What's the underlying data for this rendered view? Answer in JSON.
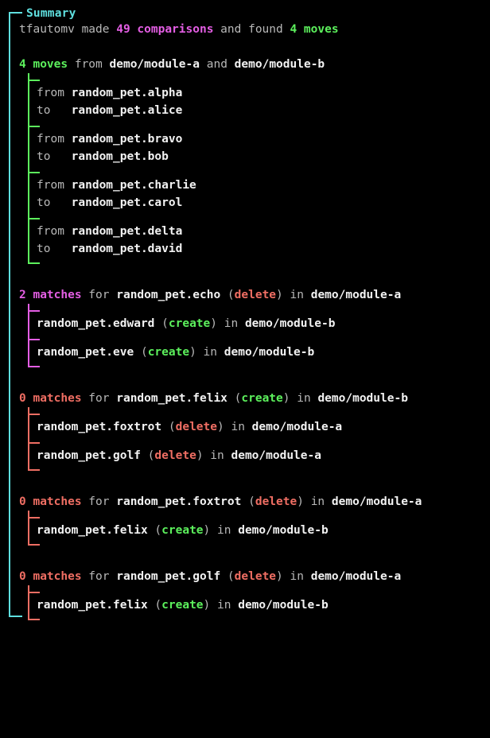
{
  "box": {
    "title": "Summary",
    "border_color": "#5fdfdf"
  },
  "summary_line": {
    "prefix": "tfautomv made ",
    "comparisons": "49 comparisons",
    "middle": " and found ",
    "moves": "4 moves"
  },
  "colors": {
    "green": "#5cf05c",
    "magenta": "#e45ee4",
    "salmon": "#ef6e63",
    "cyan": "#5fdfdf",
    "dim": "#b8b8b8",
    "white": "#f2f2f2"
  },
  "moves_group": {
    "count_label": "4 moves",
    "from_word": "from",
    "and_word": "and",
    "module_a": "demo/module-a",
    "module_b": "demo/module-b",
    "from_label": "from",
    "to_label": "to",
    "moves": [
      {
        "from": "random_pet.alpha",
        "to": "random_pet.alice"
      },
      {
        "from": "random_pet.bravo",
        "to": "random_pet.bob"
      },
      {
        "from": "random_pet.charlie",
        "to": "random_pet.carol"
      },
      {
        "from": "random_pet.delta",
        "to": "random_pet.david"
      }
    ]
  },
  "match_groups": [
    {
      "count_label": "2 matches",
      "count_color": "magenta",
      "for_word": "for",
      "resource": "random_pet.echo",
      "action": "delete",
      "action_color": "salmon",
      "in_word": "in",
      "module": "demo/module-a",
      "children": [
        {
          "resource": "random_pet.edward",
          "action": "create",
          "action_color": "green",
          "in_word": "in",
          "module": "demo/module-b"
        },
        {
          "resource": "random_pet.eve",
          "action": "create",
          "action_color": "green",
          "in_word": "in",
          "module": "demo/module-b"
        }
      ]
    },
    {
      "count_label": "0 matches",
      "count_color": "salmon",
      "for_word": "for",
      "resource": "random_pet.felix",
      "action": "create",
      "action_color": "green",
      "in_word": "in",
      "module": "demo/module-b",
      "children": [
        {
          "resource": "random_pet.foxtrot",
          "action": "delete",
          "action_color": "salmon",
          "in_word": "in",
          "module": "demo/module-a"
        },
        {
          "resource": "random_pet.golf",
          "action": "delete",
          "action_color": "salmon",
          "in_word": "in",
          "module": "demo/module-a"
        }
      ]
    },
    {
      "count_label": "0 matches",
      "count_color": "salmon",
      "for_word": "for",
      "resource": "random_pet.foxtrot",
      "action": "delete",
      "action_color": "salmon",
      "in_word": "in",
      "module": "demo/module-a",
      "children": [
        {
          "resource": "random_pet.felix",
          "action": "create",
          "action_color": "green",
          "in_word": "in",
          "module": "demo/module-b"
        }
      ]
    },
    {
      "count_label": "0 matches",
      "count_color": "salmon",
      "for_word": "for",
      "resource": "random_pet.golf",
      "action": "delete",
      "action_color": "salmon",
      "in_word": "in",
      "module": "demo/module-a",
      "children": [
        {
          "resource": "random_pet.felix",
          "action": "create",
          "action_color": "green",
          "in_word": "in",
          "module": "demo/module-b"
        }
      ]
    }
  ]
}
